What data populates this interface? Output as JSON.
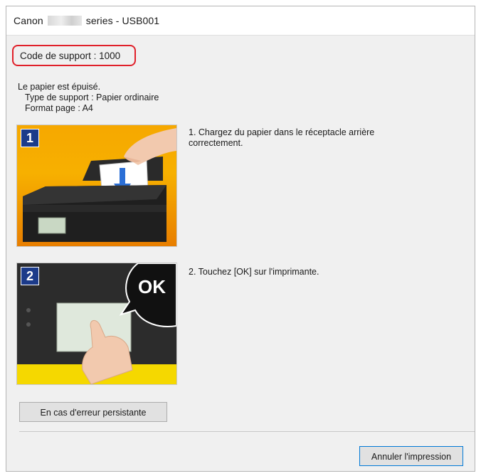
{
  "window": {
    "title_prefix": "Canon",
    "title_suffix": "series - USB001"
  },
  "support_code": "Code de support : 1000",
  "message": {
    "line1": "Le papier est épuisé.",
    "line2": "Type de support : Papier ordinaire",
    "line3": "Format page : A4"
  },
  "steps": [
    {
      "number": "1",
      "text": "1.  Chargez du papier dans le réceptacle arrière correctement."
    },
    {
      "number": "2",
      "text": "2.  Touchez [OK] sur l'imprimante."
    }
  ],
  "illustration": {
    "ok_label": "OK"
  },
  "buttons": {
    "persistent_error": "En cas d'erreur persistante",
    "cancel_print": "Annuler l'impression"
  },
  "colors": {
    "highlight": "#e0202a",
    "step_badge": "#1c3b8a",
    "panel1": "#f6a800",
    "panel2": "#f5d800"
  }
}
